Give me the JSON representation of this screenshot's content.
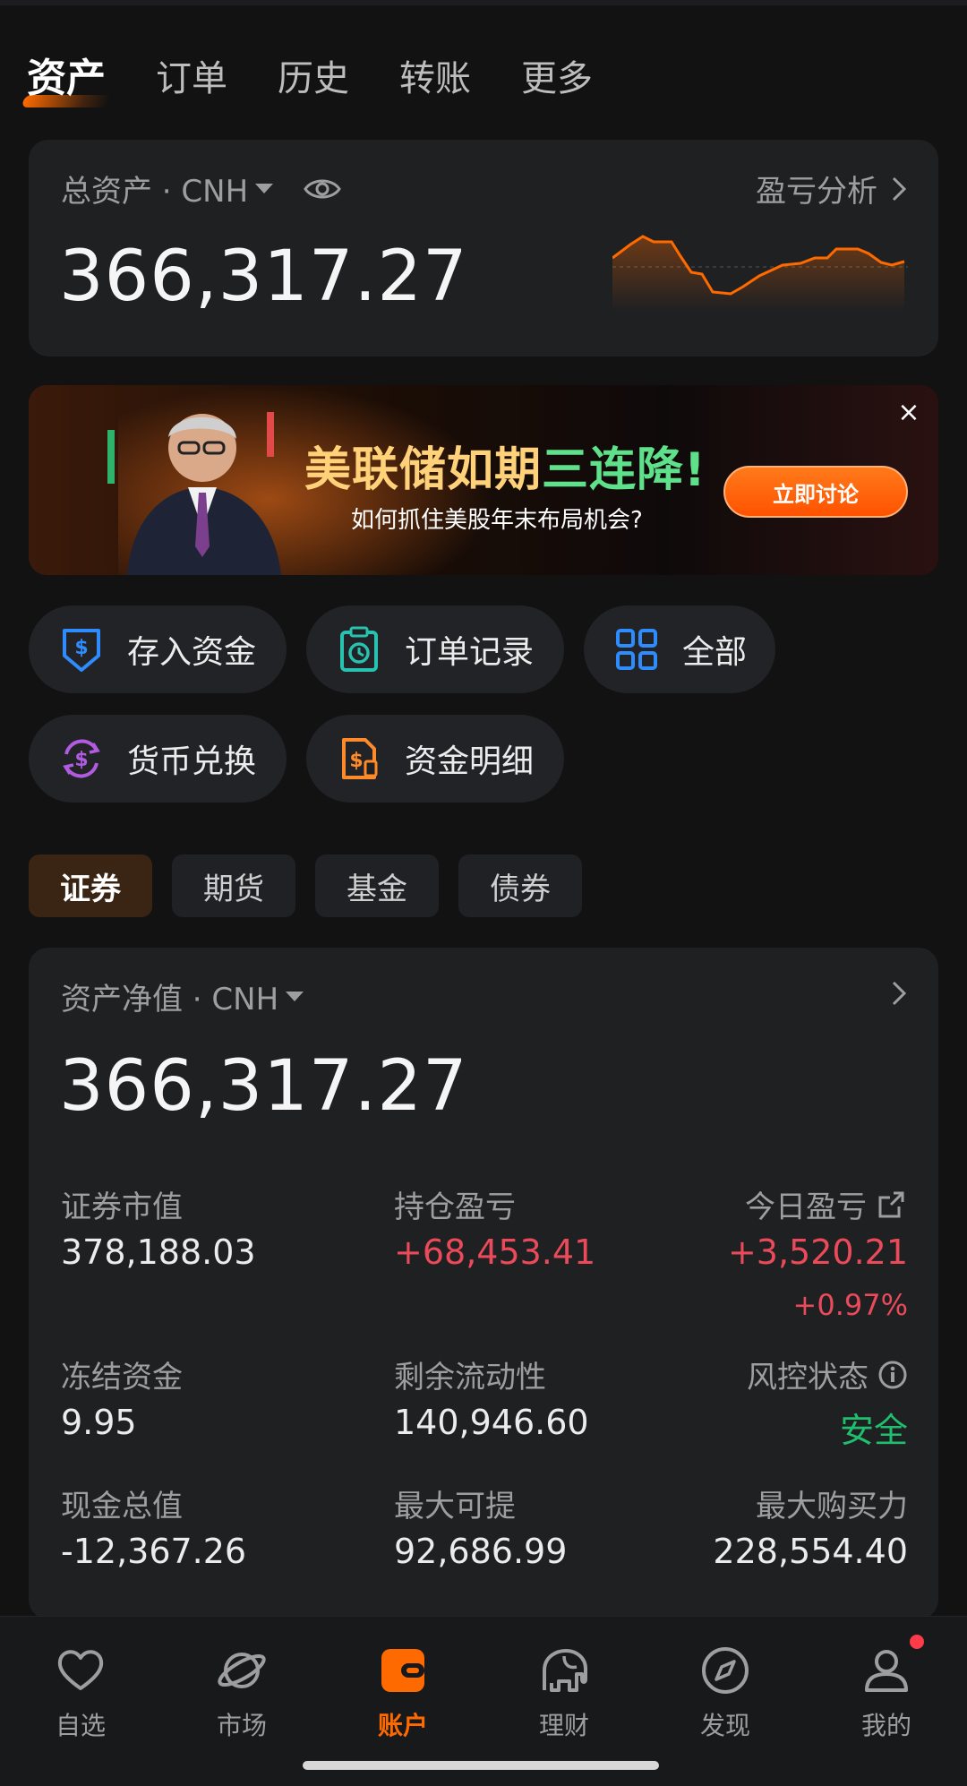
{
  "tabs": [
    "资产",
    "订单",
    "历史",
    "转账",
    "更多"
  ],
  "total": {
    "label": "总资产 · CNH",
    "pl_link": "盈亏分析",
    "value": "366,317.27",
    "accent": "#ff6a00"
  },
  "banner": {
    "title_a": "美联储如期",
    "title_b": "三连降!",
    "subtitle": "如何抓住美股年末布局机会?",
    "button": "立即讨论",
    "close": "×"
  },
  "actions": [
    {
      "label": "存入资金",
      "icon": "deposit-icon",
      "color": "#2f8cff"
    },
    {
      "label": "订单记录",
      "icon": "clipboard-clock-icon",
      "color": "#27c2b0"
    },
    {
      "label": "全部",
      "icon": "grid-icon",
      "color": "#2f8cff"
    },
    {
      "label": "货币兑换",
      "icon": "currency-exchange-icon",
      "color": "#b05be0"
    },
    {
      "label": "资金明细",
      "icon": "fund-detail-icon",
      "color": "#ff8a2a"
    }
  ],
  "segments": [
    "证券",
    "期货",
    "基金",
    "债券"
  ],
  "net": {
    "label": "资产净值 · CNH",
    "value": "366,317.27",
    "market_value_label": "证券市值",
    "market_value": "378,188.03",
    "position_pl_label": "持仓盈亏",
    "position_pl": "+68,453.41",
    "today_pl_label": "今日盈亏",
    "today_pl": "+3,520.21",
    "today_pl_pct": "+0.97%",
    "frozen_label": "冻结资金",
    "frozen": "9.95",
    "liquidity_label": "剩余流动性",
    "liquidity": "140,946.60",
    "risk_label": "风控状态",
    "risk": "安全",
    "cash_label": "现金总值",
    "cash": "-12,367.26",
    "max_withdraw_label": "最大可提",
    "max_withdraw": "92,686.99",
    "buying_power_label": "最大购买力",
    "buying_power": "228,554.40"
  },
  "nav": [
    {
      "label": "自选",
      "icon": "heart-icon"
    },
    {
      "label": "市场",
      "icon": "planet-icon"
    },
    {
      "label": "账户",
      "icon": "wallet-icon"
    },
    {
      "label": "理财",
      "icon": "elephant-icon"
    },
    {
      "label": "发现",
      "icon": "compass-icon"
    },
    {
      "label": "我的",
      "icon": "user-icon"
    }
  ],
  "colors": {
    "up": "#ea4a5a",
    "safe": "#1fbf6d",
    "accent": "#ff6a00"
  }
}
